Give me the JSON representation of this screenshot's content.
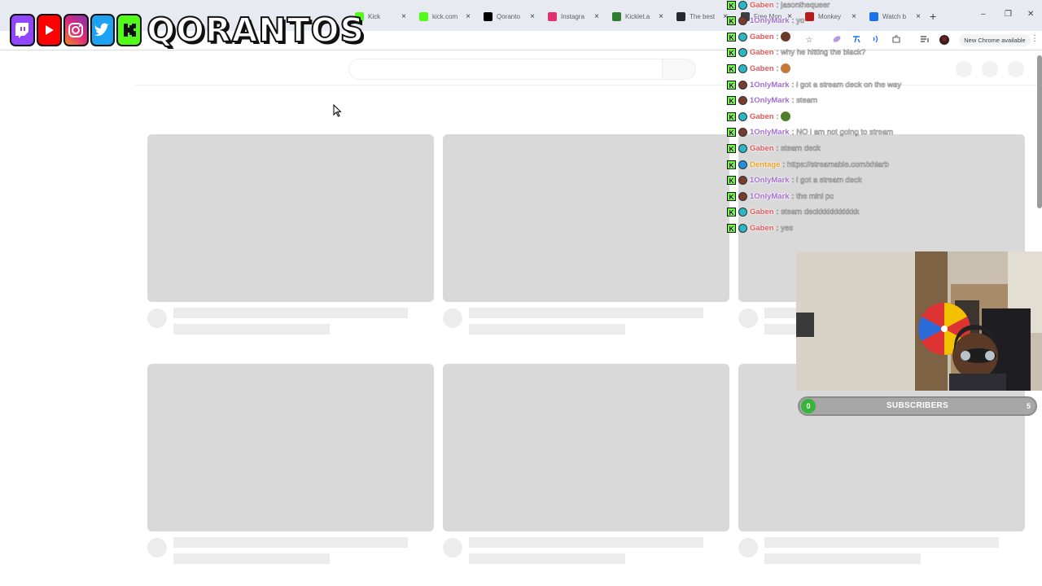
{
  "browser": {
    "tabs": [
      {
        "title": "Kick",
        "favicon_color": "#53fc18"
      },
      {
        "title": "kick.com",
        "favicon_color": "#53fc18"
      },
      {
        "title": "Qoranto",
        "favicon_color": "#000000"
      },
      {
        "title": "Instagra",
        "favicon_color": "#e1306c"
      },
      {
        "title": "Kicklet.a",
        "favicon_color": "#2e7d32"
      },
      {
        "title": "The best",
        "favicon_color": "#24292f"
      },
      {
        "title": "Free Mon",
        "favicon_color": "#3c4043"
      },
      {
        "title": "Monkey",
        "favicon_color": "#b71c1c"
      },
      {
        "title": "Watch b",
        "favicon_color": "#1a73e8"
      }
    ],
    "close_glyph": "×",
    "new_tab_glyph": "+",
    "window_buttons": [
      "–",
      "❐",
      "✕"
    ],
    "update_label": "New Chrome available",
    "menu_glyph": "⋮"
  },
  "overlay": {
    "brand": "QORANTOS",
    "socials": [
      "twitch-icon",
      "youtube-icon",
      "instagram-icon",
      "twitter-icon",
      "kick-icon"
    ],
    "chat": [
      {
        "user": "Gaben",
        "color": "#e05a5a",
        "text": "jasonthequeer",
        "badge": "#2ab7c5"
      },
      {
        "user": "1OnlyMark",
        "color": "#a46fd1",
        "text": "yo",
        "badge": "#7a3b2e"
      },
      {
        "user": "Gaben",
        "color": "#e05a5a",
        "text": "",
        "badge": "#2ab7c5",
        "emote": "#6b3a2a"
      },
      {
        "user": "Gaben",
        "color": "#e05a5a",
        "text": "why he hitting the black?",
        "badge": "#2ab7c5"
      },
      {
        "user": "Gaben",
        "color": "#e05a5a",
        "text": "",
        "badge": "#2ab7c5",
        "emote": "#c47a3a"
      },
      {
        "user": "1OnlyMark",
        "color": "#a46fd1",
        "text": "i got a stream deck on the way",
        "badge": "#7a3b2e"
      },
      {
        "user": "1OnlyMark",
        "color": "#a46fd1",
        "text": "steam",
        "badge": "#7a3b2e"
      },
      {
        "user": "Gaben",
        "color": "#e05a5a",
        "text": "",
        "badge": "#2ab7c5",
        "emote": "#4f7f2a"
      },
      {
        "user": "1OnlyMark",
        "color": "#a46fd1",
        "text": "NO i am not going to stream",
        "badge": "#7a3b2e"
      },
      {
        "user": "Gaben",
        "color": "#e05a5a",
        "text": "steam deck",
        "badge": "#2ab7c5"
      },
      {
        "user": "Dentage",
        "color": "#f0a020",
        "text": "https://streamable.com/xhiarb",
        "badge": "#1f8fd8"
      },
      {
        "user": "1OnlyMark",
        "color": "#a46fd1",
        "text": "i got a stream deck",
        "badge": "#7a3b2e"
      },
      {
        "user": "1OnlyMark",
        "color": "#a46fd1",
        "text": "the mini pc",
        "badge": "#7a3b2e"
      },
      {
        "user": "Gaben",
        "color": "#e05a5a",
        "text": "steam deckkkkkkkkkkk",
        "badge": "#2ab7c5"
      },
      {
        "user": "Gaben",
        "color": "#e05a5a",
        "text": "yes",
        "badge": "#2ab7c5"
      }
    ],
    "subscriber_goal": {
      "current": "0",
      "label": "SUBSCRIBERS",
      "goal": "5"
    }
  }
}
